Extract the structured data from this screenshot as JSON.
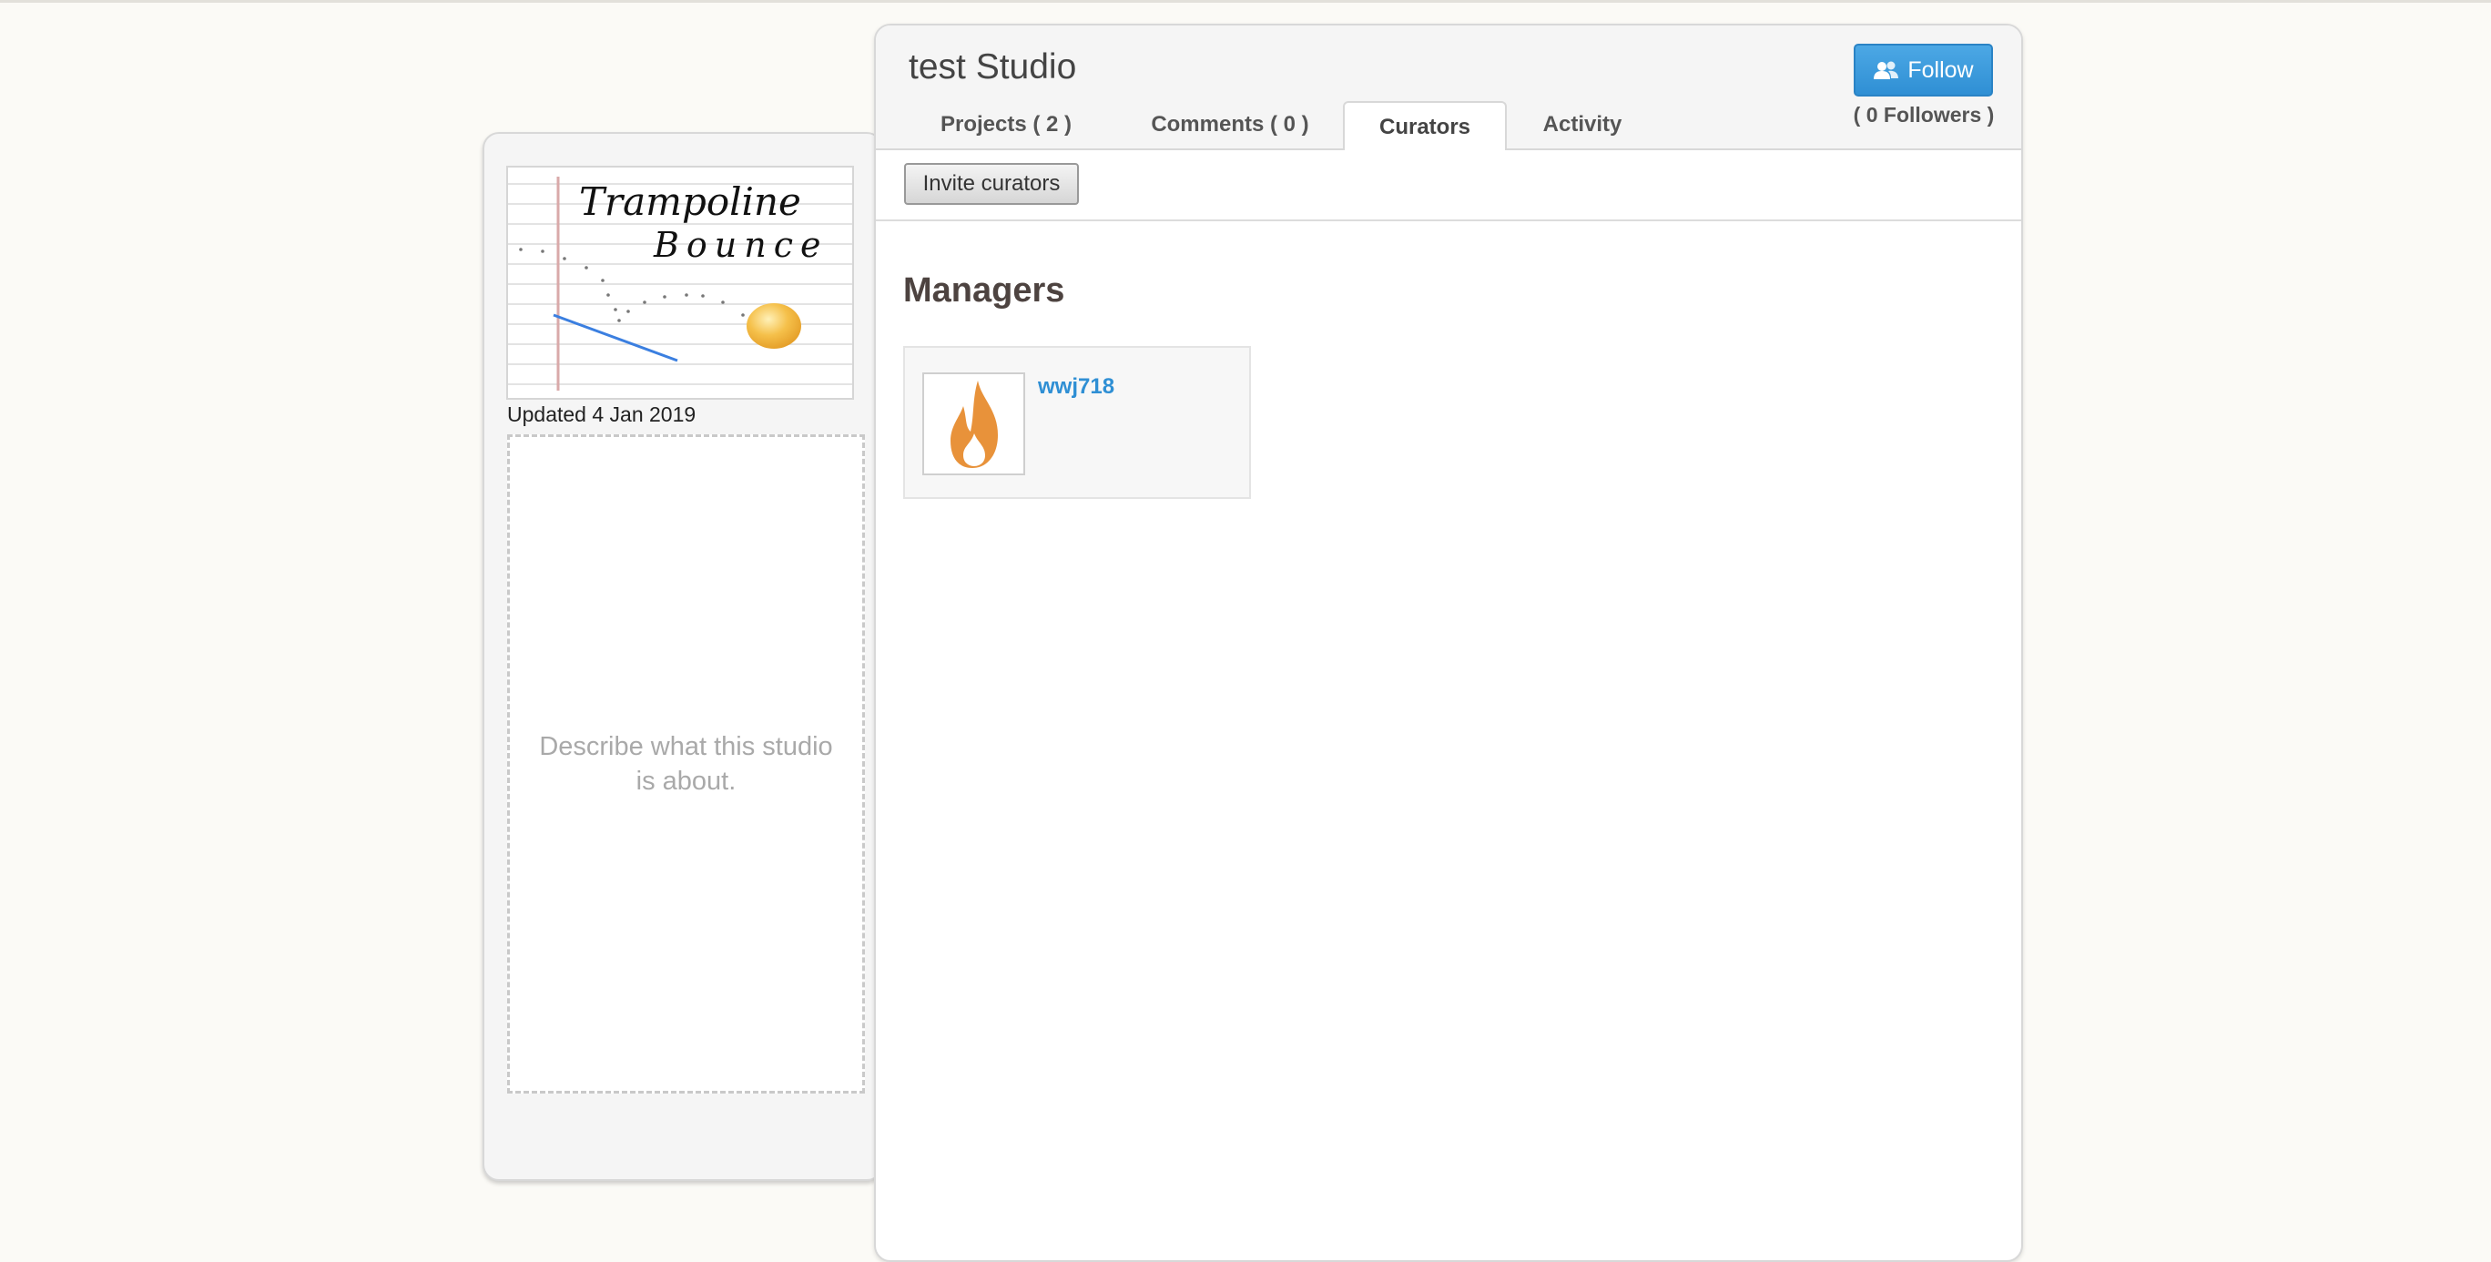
{
  "studio": {
    "title": "test Studio",
    "updated": "Updated 4 Jan 2019",
    "description_placeholder": "Describe what this studio is about.",
    "thumbnail_text_line1": "Trampoline",
    "thumbnail_text_line2": "Bounce"
  },
  "tabs": [
    {
      "label": "Projects ( 2 )",
      "active": false
    },
    {
      "label": "Comments ( 0 )",
      "active": false
    },
    {
      "label": "Curators",
      "active": true
    },
    {
      "label": "Activity",
      "active": false
    }
  ],
  "follow": {
    "button_label": "Follow",
    "followers_text": "( 0 Followers )",
    "icon": "users-icon"
  },
  "toolbar": {
    "invite_label": "Invite curators"
  },
  "managers": {
    "title": "Managers",
    "items": [
      {
        "username": "wwj718",
        "avatar_icon": "flame-icon"
      }
    ]
  },
  "colors": {
    "accent": "#2f8fd4",
    "flame": "#e8923a"
  }
}
